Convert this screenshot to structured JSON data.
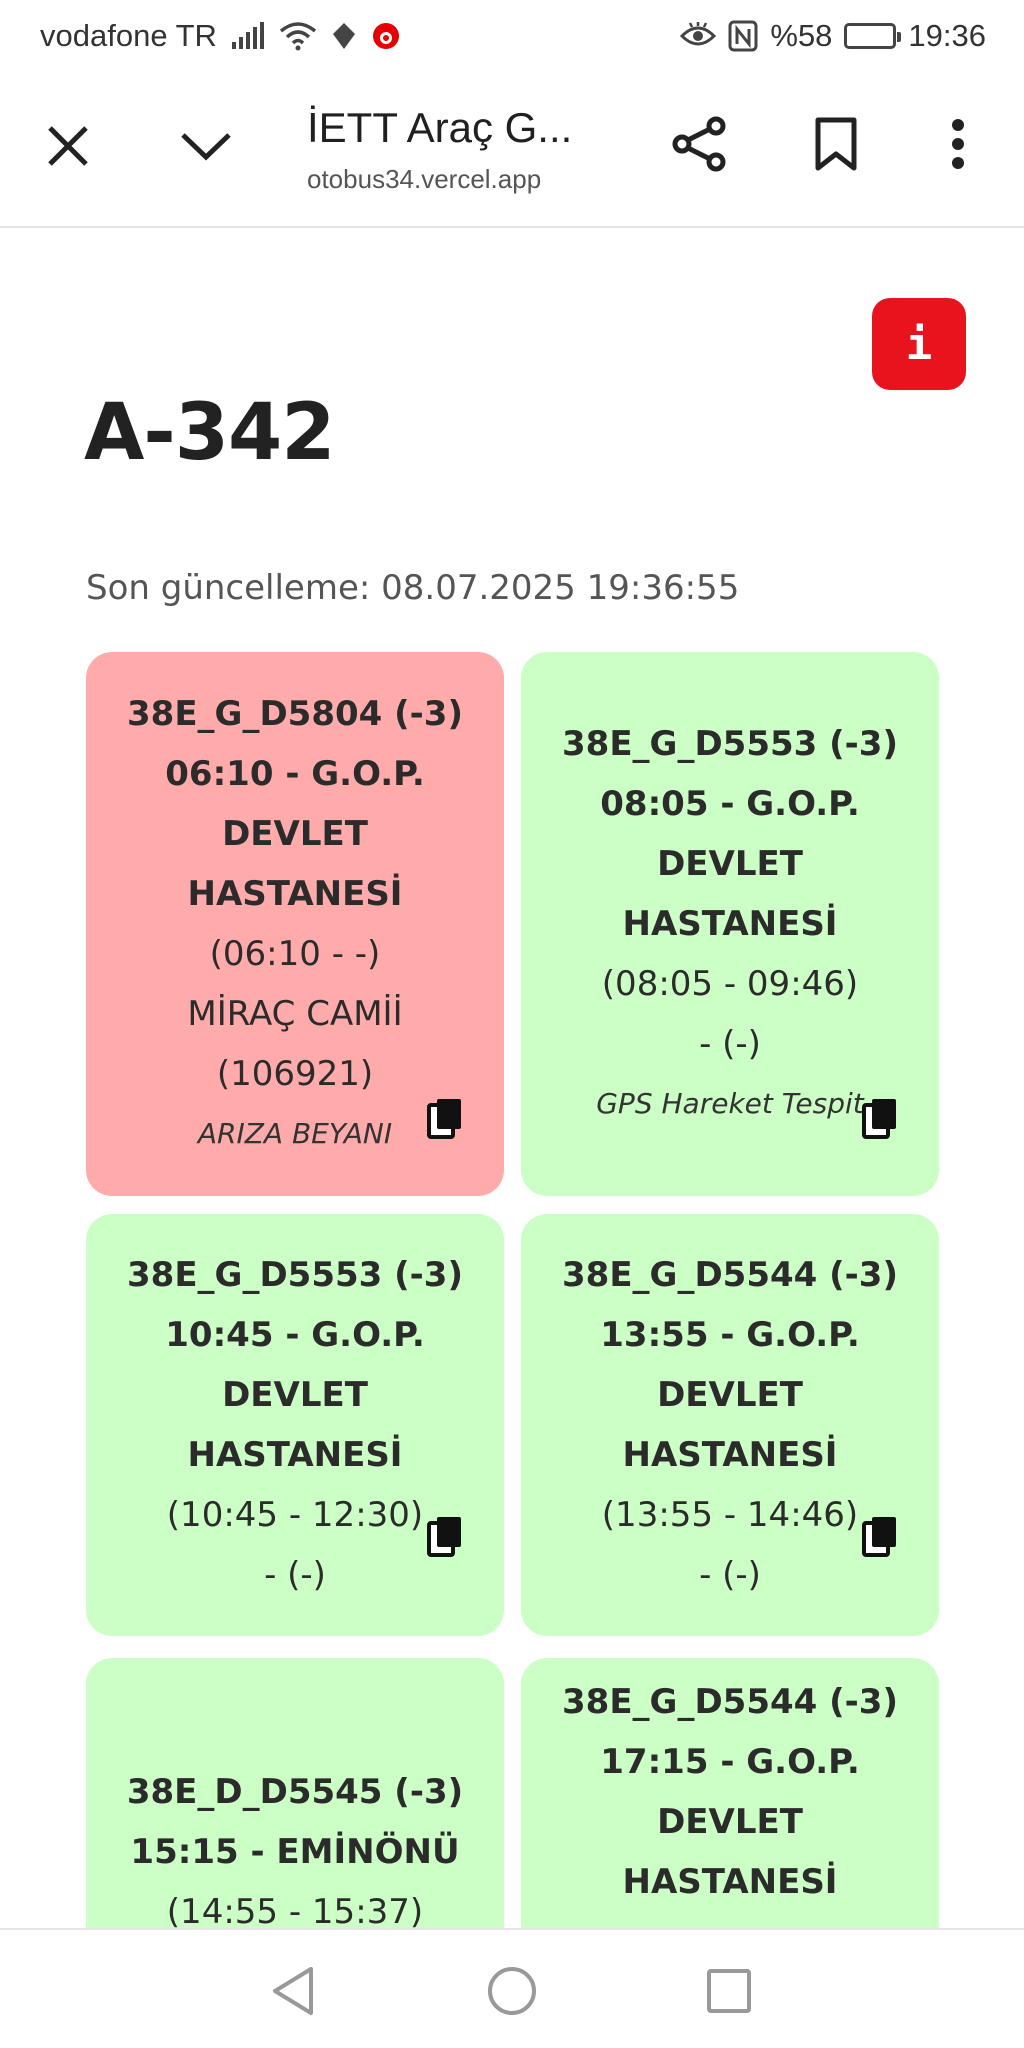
{
  "status": {
    "carrier": "vodafone TR",
    "battery": "%58",
    "time": "19:36",
    "battery_level": 0.58
  },
  "toolbar": {
    "title": "İETT Araç G...",
    "url": "otobus34.vercel.app"
  },
  "page": {
    "title": "A-342",
    "last_update": "Son güncelleme: 08.07.2025 19:36:55",
    "info_label": "i"
  },
  "cards": [
    {
      "status": "red",
      "title": "38E_G_D5804 (-3)",
      "departure": "06:10 - G.O.P.",
      "destination_1": "DEVLET",
      "destination_2": "HASTANESİ",
      "times": "(06:10 - -)",
      "stop": "MİRAÇ CAMİİ",
      "stop_code": "(106921)",
      "note": "ARIZA BEYANI"
    },
    {
      "status": "green",
      "title": "38E_G_D5553 (-3)",
      "departure": "08:05 - G.O.P.",
      "destination_1": "DEVLET",
      "destination_2": "HASTANESİ",
      "times": "(08:05 - 09:46)",
      "stop": "- (-)",
      "note": "GPS Hareket Tespit"
    },
    {
      "status": "green",
      "title": "38E_G_D5553 (-3)",
      "departure": "10:45 - G.O.P.",
      "destination_1": "DEVLET",
      "destination_2": "HASTANESİ",
      "times": "(10:45 - 12:30)",
      "stop": "- (-)"
    },
    {
      "status": "green",
      "title": "38E_G_D5544 (-3)",
      "departure": "13:55 - G.O.P.",
      "destination_1": "DEVLET",
      "destination_2": "HASTANESİ",
      "times": "(13:55 - 14:46)",
      "stop": "- (-)"
    },
    {
      "status": "green",
      "title": "38E_D_D5545 (-3)",
      "departure": "15:15 - EMİNÖNÜ",
      "times": "(14:55 - 15:37)"
    },
    {
      "status": "green",
      "title": "38E_G_D5544 (-3)",
      "departure": "17:15 - G.O.P.",
      "destination_1": "DEVLET",
      "destination_2": "HASTANESİ"
    }
  ],
  "icons": {
    "close": "close-icon",
    "collapse": "chevron-down-icon",
    "share": "share-icon",
    "bookmark": "bookmark-icon",
    "menu": "more-vert-icon",
    "copy": "copy-icon"
  },
  "colors": {
    "red_card": "#ffabab",
    "green_card": "#ccffc5",
    "info_button": "#e8131d"
  }
}
